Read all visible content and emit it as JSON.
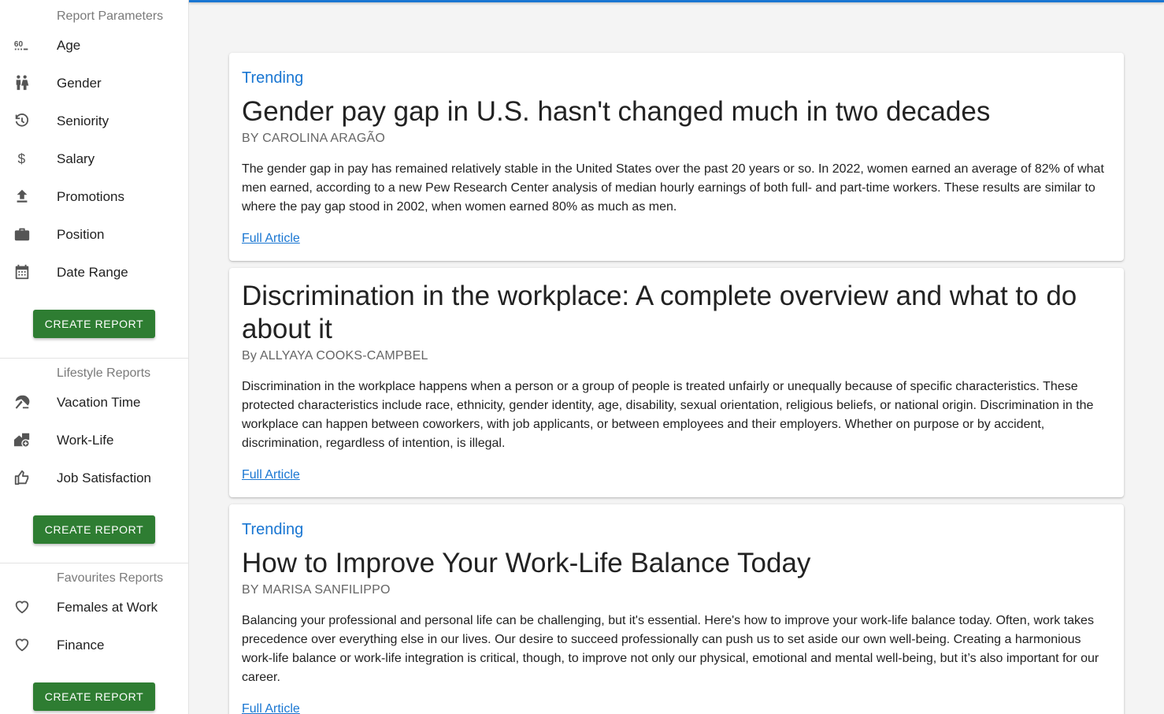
{
  "sidebar": {
    "report_parameters": {
      "title": "Report Parameters",
      "items": [
        {
          "label": "Age",
          "icon": "age-60-icon"
        },
        {
          "label": "Gender",
          "icon": "gender-icon"
        },
        {
          "label": "Seniority",
          "icon": "history-icon"
        },
        {
          "label": "Salary",
          "icon": "dollar-icon"
        },
        {
          "label": "Promotions",
          "icon": "upload-icon"
        },
        {
          "label": "Position",
          "icon": "briefcase-icon"
        },
        {
          "label": "Date Range",
          "icon": "calendar-icon"
        }
      ],
      "button": "CREATE REPORT"
    },
    "lifestyle_reports": {
      "title": "Lifestyle Reports",
      "items": [
        {
          "label": "Vacation Time",
          "icon": "beach-umbrella-icon"
        },
        {
          "label": "Work-Life",
          "icon": "home-work-icon"
        },
        {
          "label": "Job Satisfaction",
          "icon": "thumb-up-icon"
        }
      ],
      "button": "CREATE REPORT"
    },
    "favourites_reports": {
      "title": "Favourites Reports",
      "items": [
        {
          "label": "Females at Work",
          "icon": "heart-outline-icon"
        },
        {
          "label": "Finance",
          "icon": "heart-outline-icon"
        }
      ],
      "button": "CREATE REPORT"
    }
  },
  "articles": [
    {
      "tag": "Trending",
      "title": "Gender pay gap in U.S. hasn't changed much in two decades",
      "byline": "BY CAROLINA ARAGÃO",
      "body": "The gender gap in pay has remained relatively stable in the United States over the past 20 years or so. In 2022, women earned an average of 82% of what men earned, according to a new Pew Research Center analysis of median hourly earnings of both full- and part-time workers. These results are similar to where the pay gap stood in 2002, when women earned 80% as much as men.",
      "link": "Full Article"
    },
    {
      "tag": "",
      "title": "Discrimination in the workplace: A complete overview and what to do about it",
      "byline": "By ALLYAYA COOKS-CAMPBEL",
      "body": "Discrimination in the workplace happens when a person or a group of people is treated unfairly or unequally because of specific characteristics. These protected characteristics include race, ethnicity, gender identity, age, disability, sexual orientation, religious beliefs, or national origin. Discrimination in the workplace can happen between coworkers, with job applicants, or between employees and their employers. Whether on purpose or by accident, discrimination, regardless of intention, is illegal.",
      "link": "Full Article"
    },
    {
      "tag": "Trending",
      "title": "How to Improve Your Work-Life Balance Today",
      "byline": "BY MARISA SANFILIPPO",
      "body": "Balancing your professional and personal life can be challenging, but it's essential. Here's how to improve your work-life balance today. Often, work takes precedence over everything else in our lives. Our desire to succeed professionally can push us to set aside our own well-being. Creating a harmonious work-life balance or work-life integration is critical, though, to improve not only our physical, emotional and mental well-being, but it’s also important for our career.",
      "link": "Full Article"
    }
  ],
  "colors": {
    "accent": "#1976d2",
    "button": "#2e7d32"
  }
}
